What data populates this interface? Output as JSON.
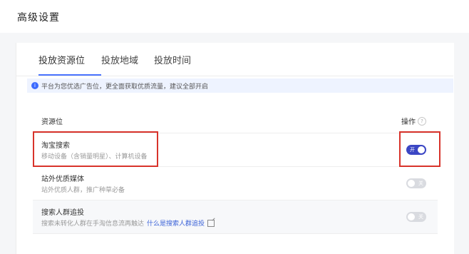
{
  "header": {
    "title": "高级设置"
  },
  "tabs": [
    {
      "label": "投放资源位",
      "active": true
    },
    {
      "label": "投放地域",
      "active": false
    },
    {
      "label": "投放时间",
      "active": false
    }
  ],
  "notice": {
    "icon": "info-icon",
    "text": "平台为您优选广告位，更全面获取优质流量，建议全部开启"
  },
  "table": {
    "col_resource": "资源位",
    "col_action": "操作",
    "rows": [
      {
        "name": "淘宝搜索",
        "desc": "移动设备（含销量明星）、计算机设备",
        "toggle_label": "开",
        "enabled": true
      },
      {
        "name": "站外优质媒体",
        "desc": "站外优质人群，推广种草必备",
        "toggle_label": "关",
        "enabled": false
      },
      {
        "name": "搜索人群追投",
        "desc": "搜索未转化人群在手淘信息流再触达",
        "link": "什么是搜索人群追投",
        "toggle_label": "关",
        "enabled": false
      }
    ]
  },
  "colors": {
    "accent": "#4a73ff",
    "toggle_on": "#3b46c4",
    "highlight": "#d8332b"
  }
}
